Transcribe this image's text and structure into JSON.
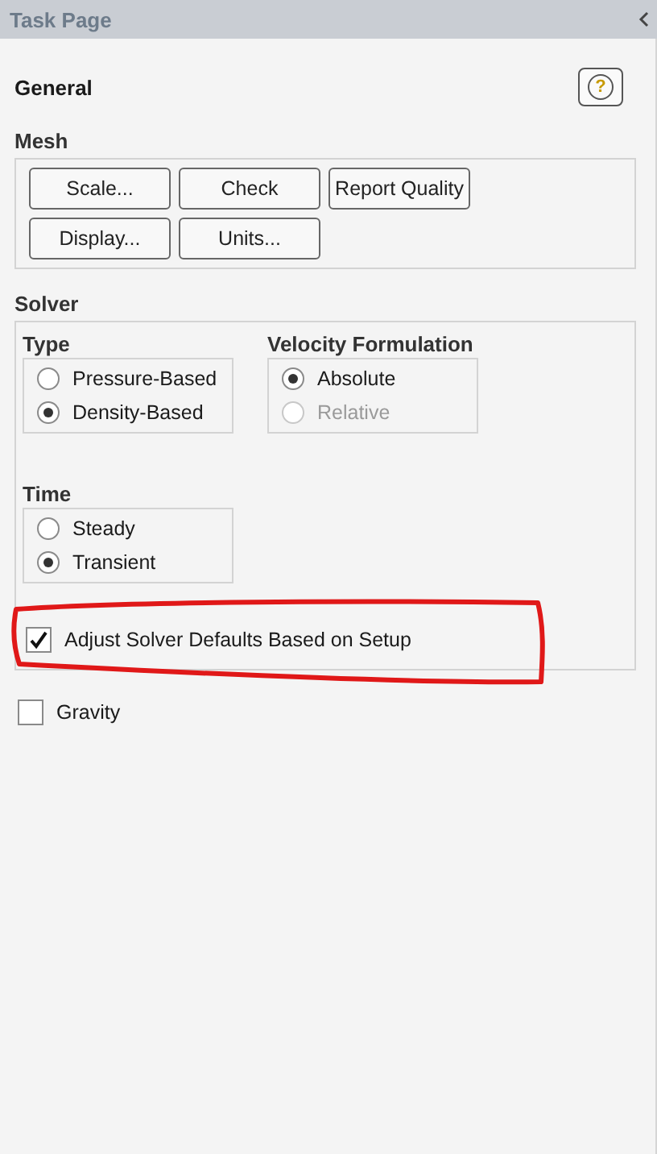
{
  "title_bar": {
    "title": "Task Page"
  },
  "heading": "General",
  "help_button": "?",
  "mesh": {
    "label": "Mesh",
    "buttons": [
      [
        "Scale...",
        "Check",
        "Report Quality"
      ],
      [
        "Display...",
        "Units..."
      ]
    ]
  },
  "solver": {
    "label": "Solver",
    "groups": [
      {
        "label": "Type",
        "options": [
          {
            "label": "Pressure-Based",
            "selected": false,
            "disabled": false
          },
          {
            "label": "Density-Based",
            "selected": true,
            "disabled": false
          }
        ]
      },
      {
        "label": "Velocity Formulation",
        "options": [
          {
            "label": "Absolute",
            "selected": true,
            "disabled": false
          },
          {
            "label": "Relative",
            "selected": false,
            "disabled": true
          }
        ]
      },
      {
        "label": "Time",
        "options": [
          {
            "label": "Steady",
            "selected": false,
            "disabled": false
          },
          {
            "label": "Transient",
            "selected": true,
            "disabled": false
          }
        ]
      }
    ],
    "checkbox": {
      "label": "Adjust Solver Defaults Based on Setup",
      "checked": true
    }
  },
  "gravity": {
    "label": "Gravity",
    "checked": false
  }
}
